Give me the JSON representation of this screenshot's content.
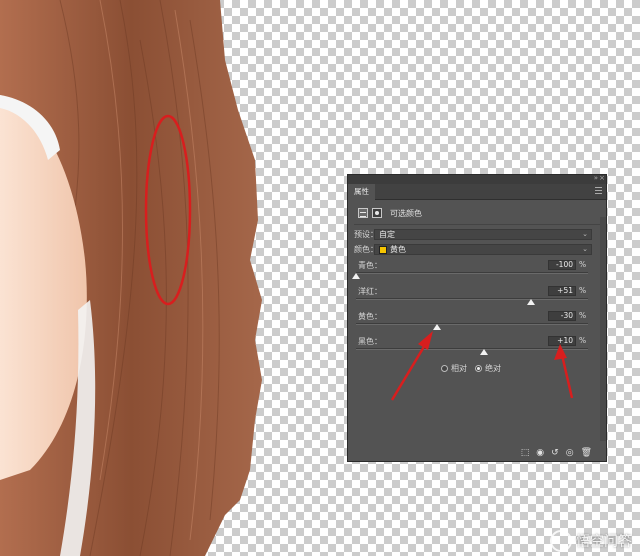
{
  "panel": {
    "collapse_icon": "»",
    "close_icon": "×",
    "tab_label": "属性",
    "header_title": "可选颜色",
    "preset": {
      "label": "预设：",
      "value": "自定"
    },
    "colors": {
      "label": "颜色：",
      "value": "黄色",
      "swatch_color": "#f5c400"
    },
    "sliders": [
      {
        "label": "青色：",
        "value": "-100",
        "unit": "%",
        "level": -100
      },
      {
        "label": "洋红：",
        "value": "+51",
        "unit": "%",
        "level": 51
      },
      {
        "label": "黄色：",
        "value": "-30",
        "unit": "%",
        "level": -30
      },
      {
        "label": "黑色：",
        "value": "+10",
        "unit": "%",
        "level": 10
      }
    ],
    "method": {
      "relative": "相对",
      "absolute": "绝对",
      "selected": "absolute"
    },
    "footer_icons": [
      "clip-icon",
      "eye-preview-icon",
      "reset-icon",
      "visibility-icon",
      "trash-icon"
    ]
  },
  "watermark": {
    "text": "悟空问答"
  },
  "colors": {
    "panel_bg": "#535353",
    "annotation_red": "#d81e1e",
    "hair": "#8a4e33"
  }
}
